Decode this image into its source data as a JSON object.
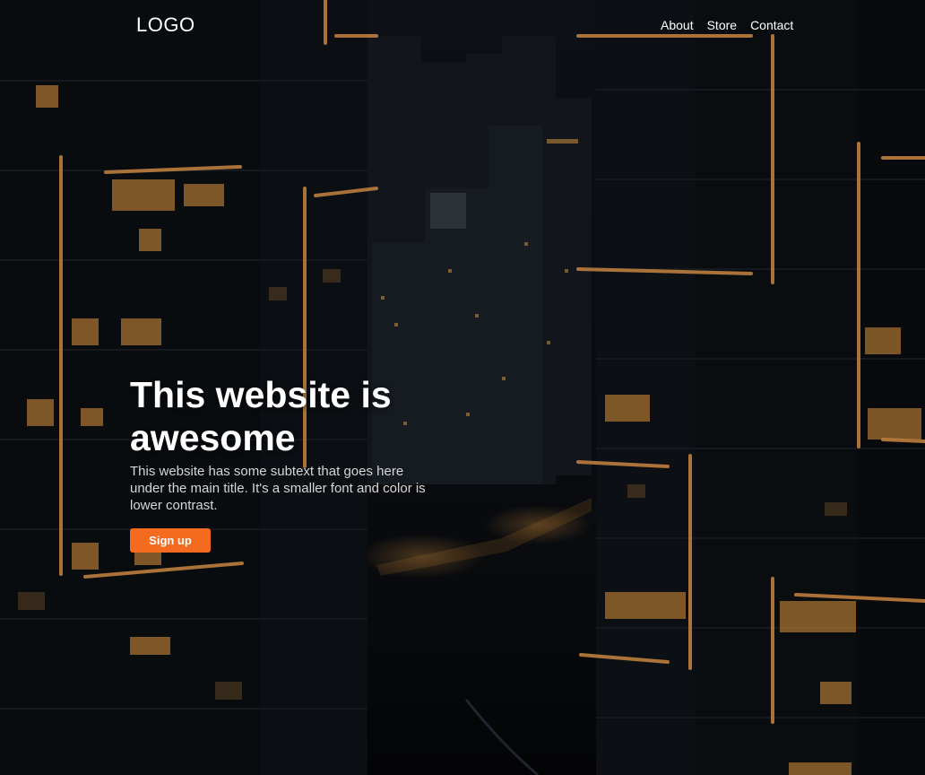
{
  "header": {
    "logo_text": "LOGO",
    "nav": [
      {
        "label": "About"
      },
      {
        "label": "Store"
      },
      {
        "label": "Contact"
      }
    ]
  },
  "hero": {
    "title": "This website is awesome",
    "subtitle": "This website has some subtext that goes here under the main title. It's a smaller font and color is lower contrast.",
    "cta_label": "Sign up"
  },
  "colors": {
    "accent": "#f46a1e",
    "background": "#07090c",
    "text": "#ffffff",
    "subtext": "#d6d6d6",
    "building_light": "#f0a34a"
  },
  "background_image": "night-city-skyscrapers"
}
